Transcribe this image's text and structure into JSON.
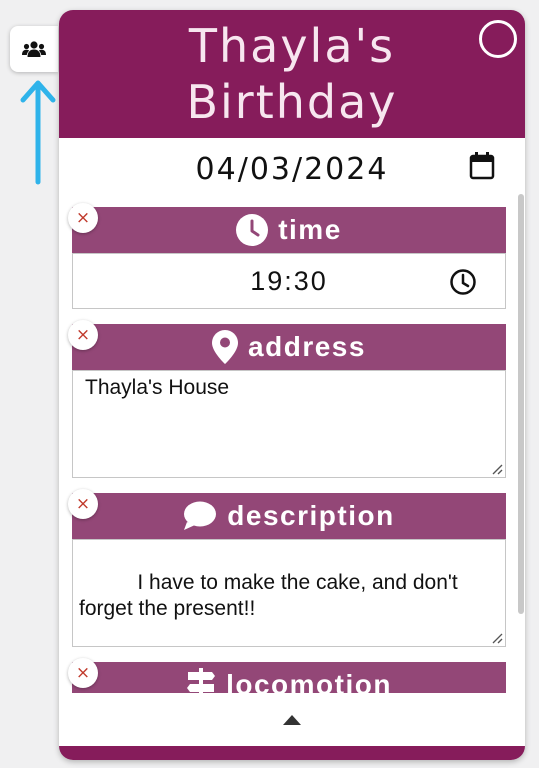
{
  "event": {
    "title_line1": "Thayla's",
    "title_line2": "Birthday",
    "date": "04/03/2024"
  },
  "fields": {
    "time": {
      "label": "time",
      "value": "19:30"
    },
    "address": {
      "label": "address",
      "value": "Thayla's House"
    },
    "description": {
      "label": "description",
      "value": "  I have to make the cake, and don't forget the present!!"
    },
    "locomotion": {
      "label": "locomotion"
    }
  },
  "controls": {
    "remove_symbol": "×",
    "side_tab_icon": "people-group-icon",
    "collapse_icon": "caret-up-icon"
  },
  "colors": {
    "header": "#861c5b",
    "field_header": "#934777",
    "arrow": "#2fb3ea",
    "remove": "#c0392b"
  }
}
